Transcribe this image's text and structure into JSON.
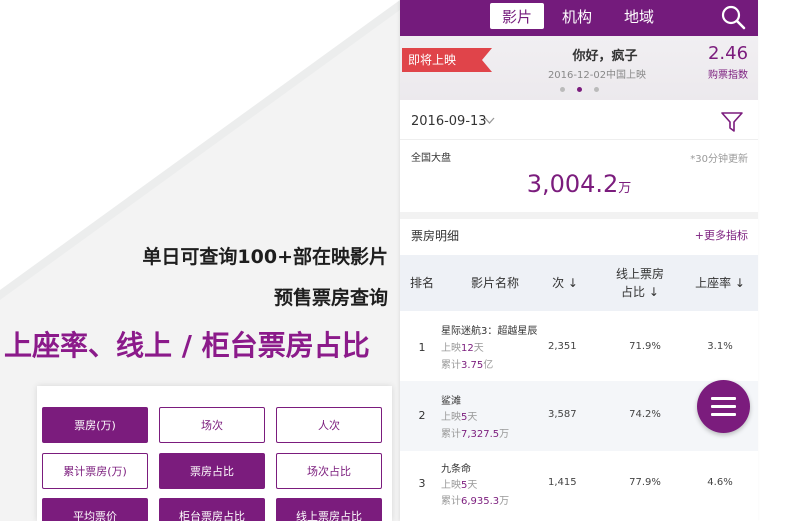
{
  "promo": {
    "line1": "单日可查询100+部在映影片",
    "line2": "预售票房查询",
    "line3": "上座率、线上 / 柜台票房占比"
  },
  "metric_buttons": [
    {
      "label": "票房(万)",
      "active": true
    },
    {
      "label": "场次",
      "active": false
    },
    {
      "label": "人次",
      "active": false
    },
    {
      "label": "累计票房(万)",
      "active": false
    },
    {
      "label": "票房占比",
      "active": true
    },
    {
      "label": "场次占比",
      "active": false
    },
    {
      "label": "平均票价",
      "active": true
    },
    {
      "label": "柜台票房占比",
      "active": true
    },
    {
      "label": "线上票房占比",
      "active": true
    }
  ],
  "tabs": [
    {
      "label": "影片",
      "active": true
    },
    {
      "label": "机构",
      "active": false
    },
    {
      "label": "地域",
      "active": false
    }
  ],
  "banner": {
    "ribbon": "即将上映",
    "title": "你好，疯子",
    "subtitle": "2016-12-02中国上映",
    "index_value": "2.46",
    "index_label": "购票指数"
  },
  "date": "2016-09-13",
  "box_office": {
    "label": "全国大盘",
    "update_note": "*30分钟更新",
    "value": "3,004.2",
    "unit": "万"
  },
  "detail": {
    "title": "票房明细",
    "more": "+更多指标"
  },
  "table": {
    "headers": [
      "排名",
      "影片名称",
      "次 ↓",
      "线上票房\n占比 ↓",
      "上座率 ↓"
    ],
    "rows": [
      {
        "rank": "1",
        "name": "星际迷航3：超越星辰",
        "released_pre": "上映",
        "released_val": "12",
        "released_post": "天",
        "total_pre": "累计",
        "total_val": "3.75",
        "total_post": "亿",
        "count": "2,351",
        "online": "71.9%",
        "seat": "3.1%"
      },
      {
        "rank": "2",
        "name": "鲨滩",
        "released_pre": "上映",
        "released_val": "5",
        "released_post": "天",
        "total_pre": "累计",
        "total_val": "7,327.5",
        "total_post": "万",
        "count": "3,587",
        "online": "74.2%",
        "seat": ""
      },
      {
        "rank": "3",
        "name": "九条命",
        "released_pre": "上映",
        "released_val": "5",
        "released_post": "天",
        "total_pre": "累计",
        "total_val": "6,935.3",
        "total_post": "万",
        "count": "1,415",
        "online": "77.9%",
        "seat": "4.6%"
      }
    ]
  },
  "icons": {
    "search": "search-icon",
    "filter": "filter-icon",
    "menu": "menu-icon",
    "chevron": "chevron-down-icon"
  },
  "colors": {
    "brand": "#741b7c",
    "accent": "#7b1c7d",
    "ribbon": "#e0444a"
  }
}
